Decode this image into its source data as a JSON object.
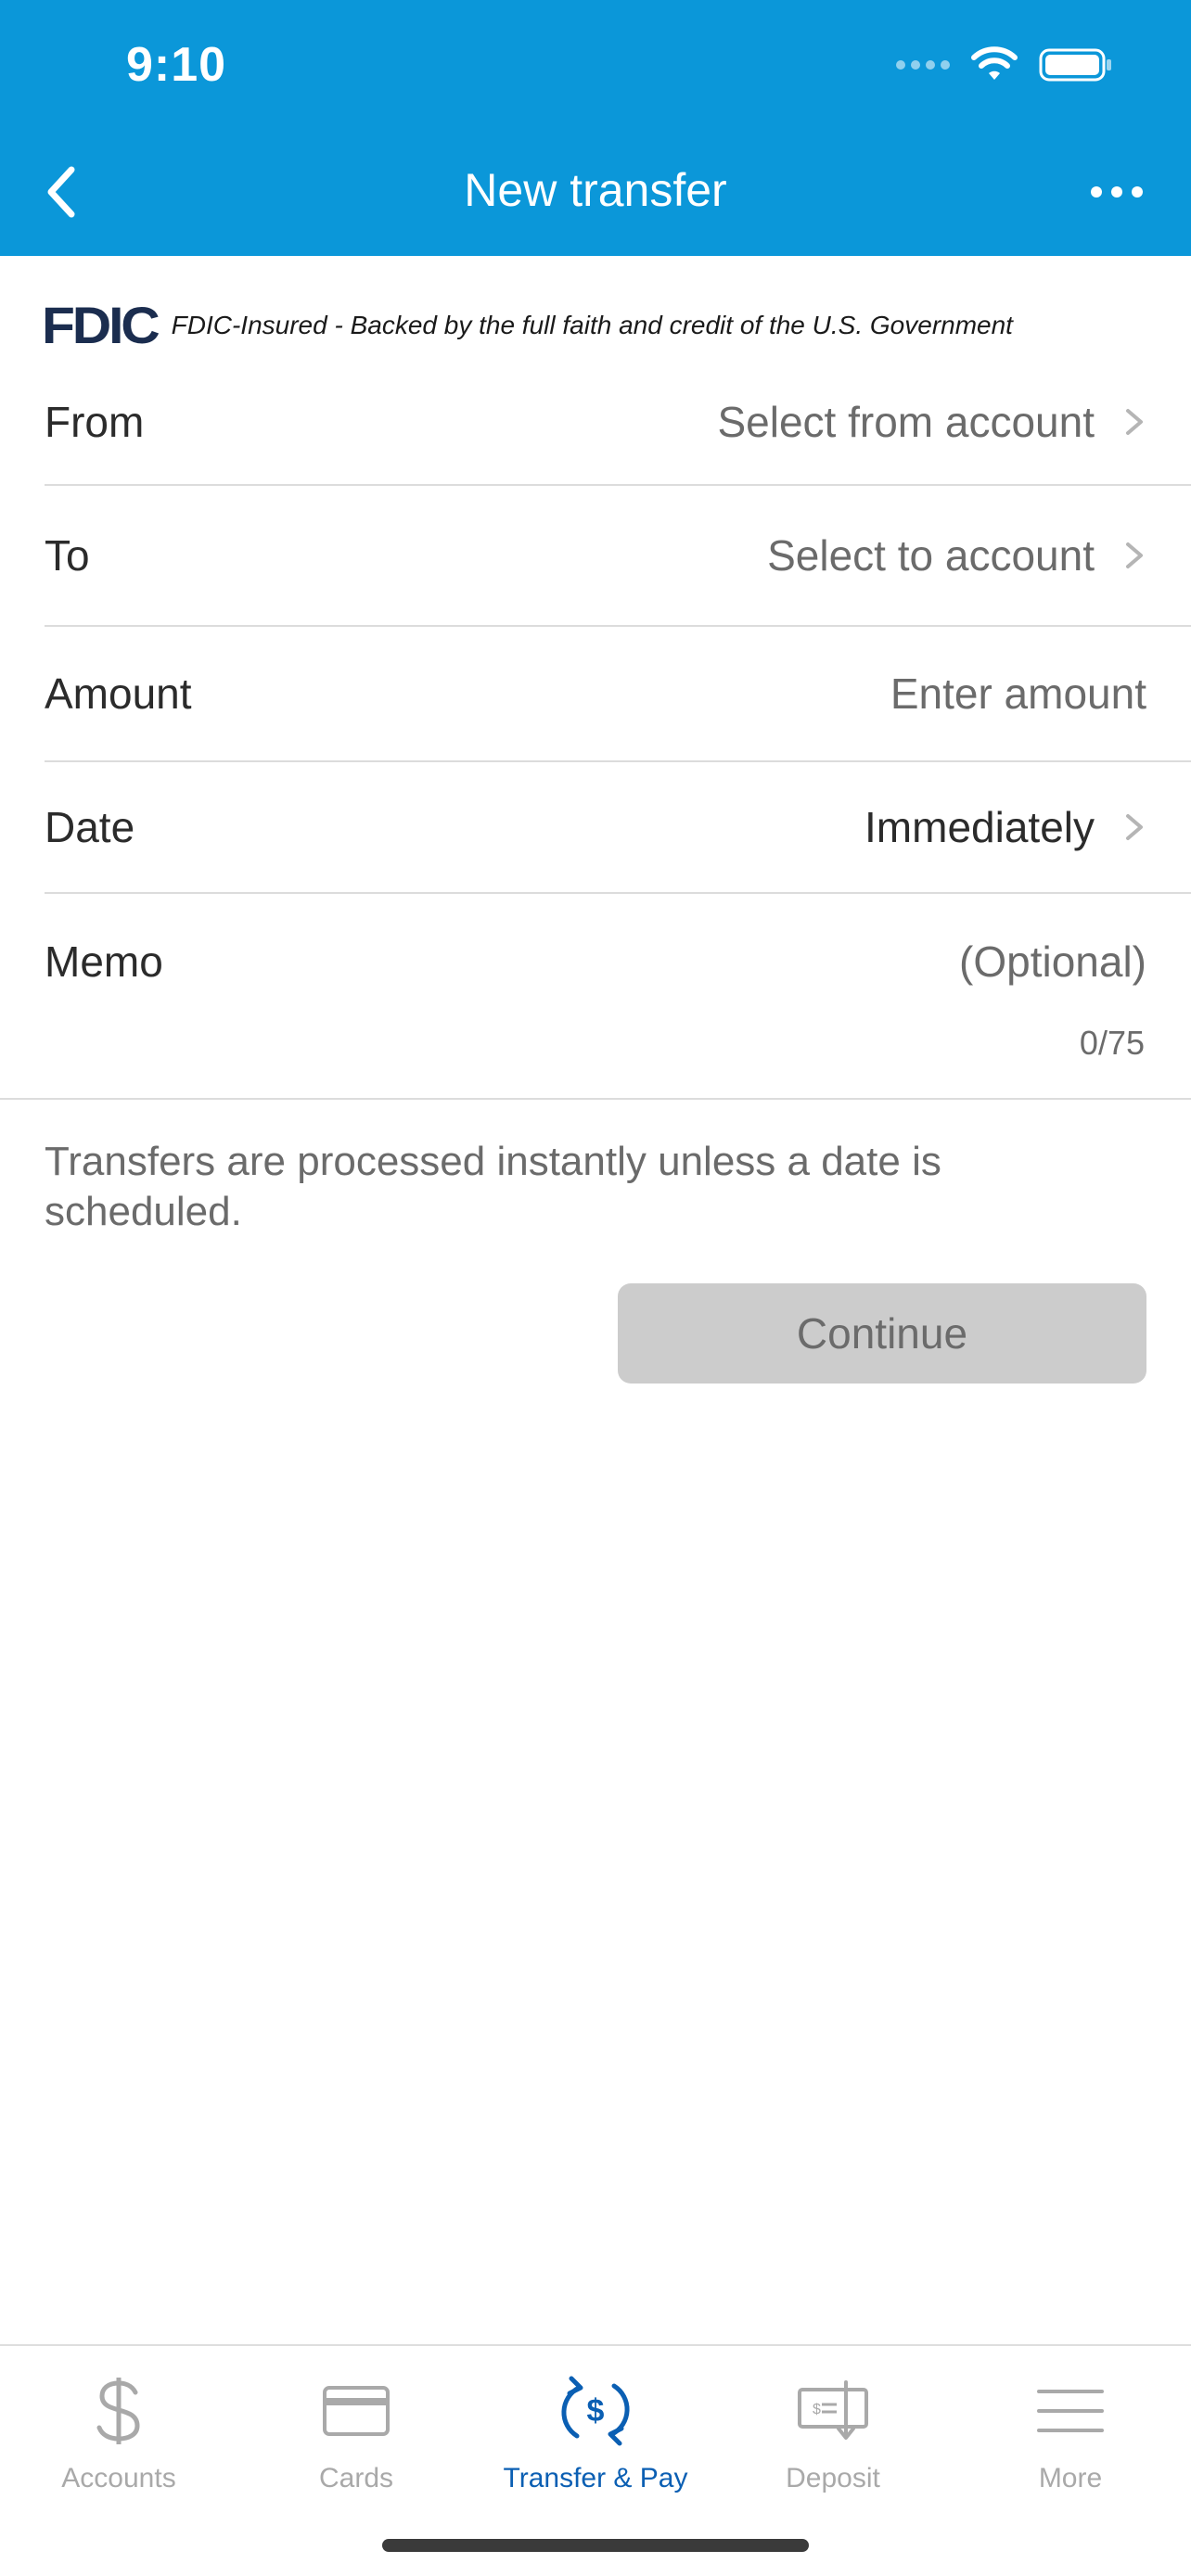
{
  "status_bar": {
    "time": "9:10"
  },
  "nav": {
    "title": "New transfer"
  },
  "fdic": {
    "logo": "FDIC",
    "text": "FDIC-Insured - Backed by the full faith and credit of the U.S. Government"
  },
  "form": {
    "from": {
      "label": "From",
      "value": "Select from account"
    },
    "to": {
      "label": "To",
      "value": "Select to account"
    },
    "amount": {
      "label": "Amount",
      "placeholder": "Enter amount"
    },
    "date": {
      "label": "Date",
      "value": "Immediately"
    },
    "memo": {
      "label": "Memo",
      "placeholder": "(Optional)",
      "counter": "0/75"
    }
  },
  "info_text": "Transfers are processed instantly unless a date is scheduled.",
  "continue_label": "Continue",
  "tabs": [
    {
      "label": "Accounts",
      "icon": "dollar-icon"
    },
    {
      "label": "Cards",
      "icon": "card-icon"
    },
    {
      "label": "Transfer & Pay",
      "icon": "transfer-icon",
      "active": true
    },
    {
      "label": "Deposit",
      "icon": "check-deposit-icon"
    },
    {
      "label": "More",
      "icon": "menu-icon"
    }
  ],
  "colors": {
    "header": "#0b97d9",
    "active_tab": "#0b5fb3",
    "disabled_button": "#cccccc"
  }
}
